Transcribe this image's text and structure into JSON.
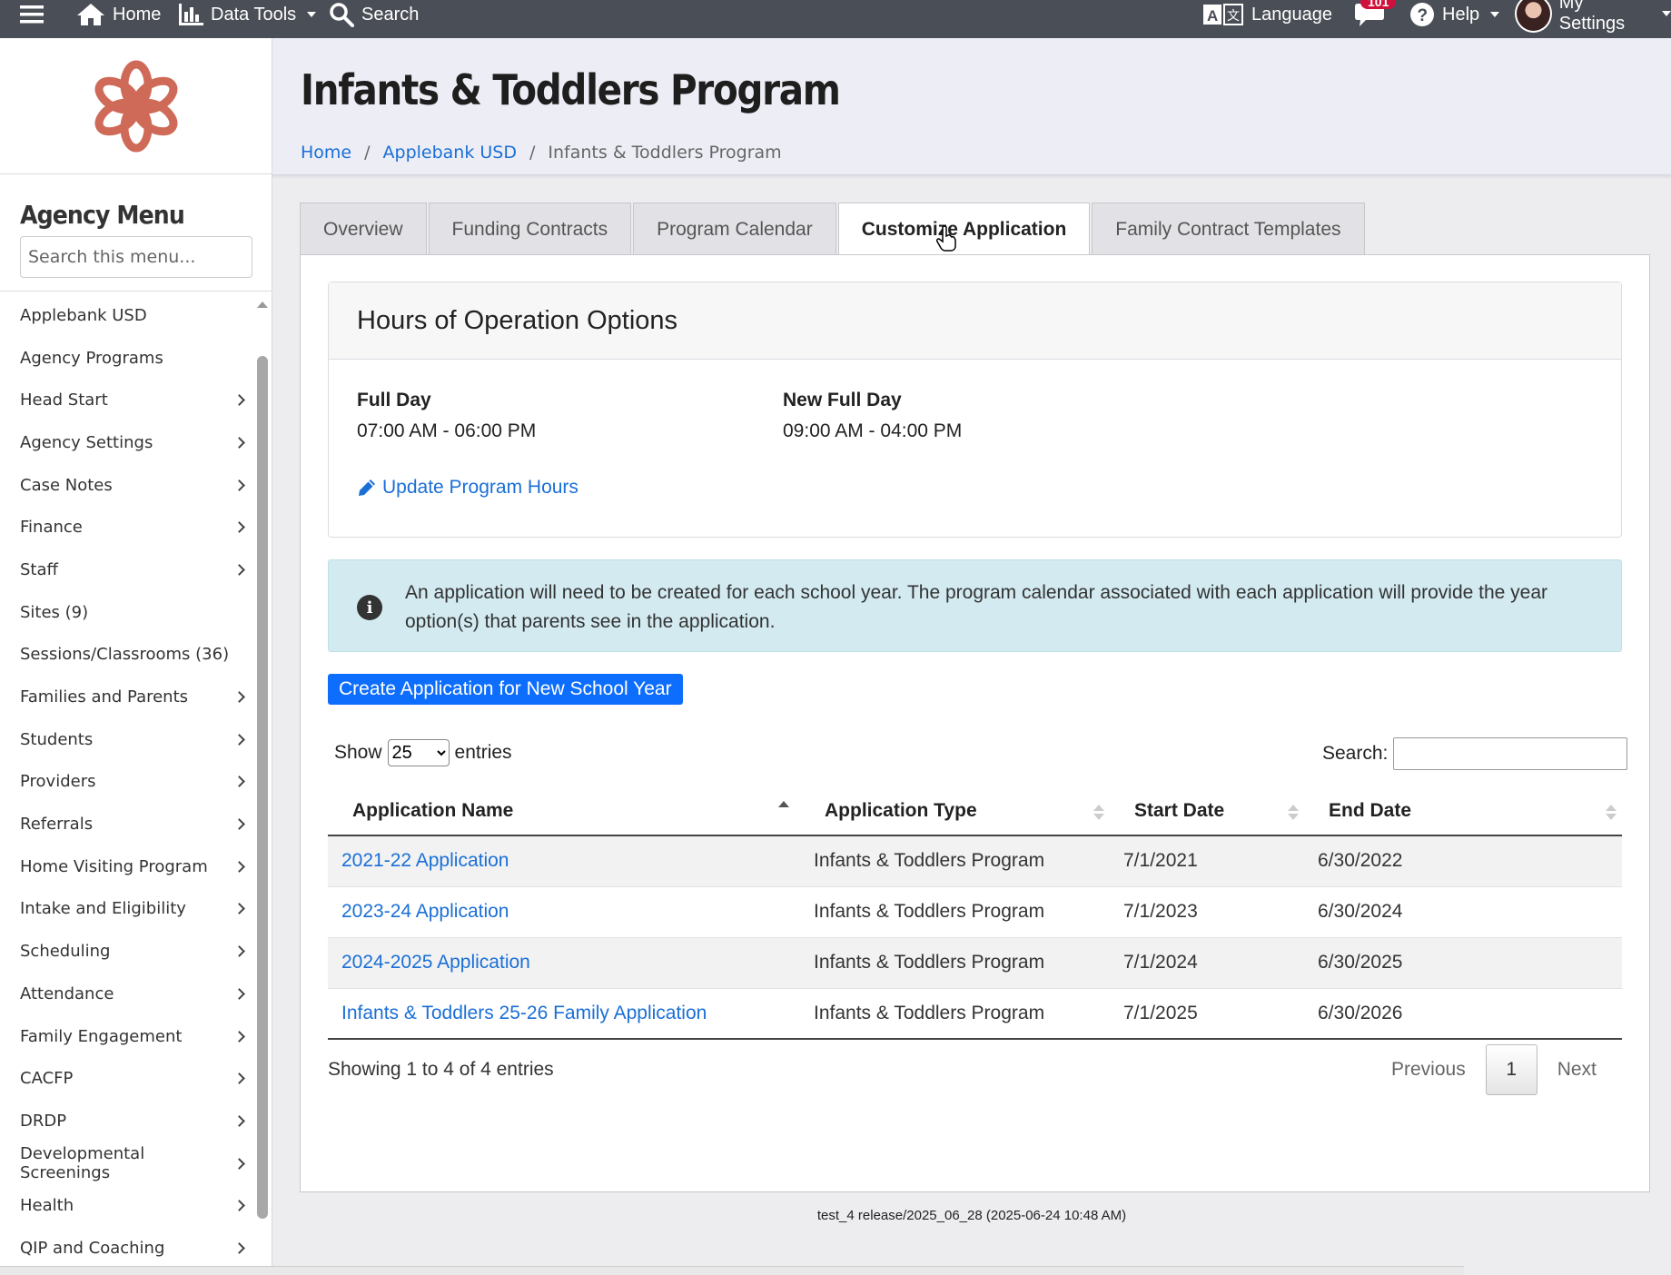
{
  "topbar": {
    "home": "Home",
    "data_tools": "Data Tools",
    "search": "Search",
    "language": "Language",
    "notifications_count": "101",
    "help": "Help",
    "my_settings": "My Settings"
  },
  "sidebar": {
    "title": "Agency Menu",
    "search_placeholder": "Search this menu...",
    "items": [
      {
        "label": "Applebank USD",
        "has_children": false
      },
      {
        "label": "Agency Programs",
        "has_children": false
      },
      {
        "label": "Head Start",
        "has_children": true
      },
      {
        "label": "Agency Settings",
        "has_children": true
      },
      {
        "label": "Case Notes",
        "has_children": true
      },
      {
        "label": "Finance",
        "has_children": true
      },
      {
        "label": "Staff",
        "has_children": true
      },
      {
        "label": "Sites (9)",
        "has_children": false
      },
      {
        "label": "Sessions/Classrooms (36)",
        "has_children": false
      },
      {
        "label": "Families and Parents",
        "has_children": true
      },
      {
        "label": "Students",
        "has_children": true
      },
      {
        "label": "Providers",
        "has_children": true
      },
      {
        "label": "Referrals",
        "has_children": true
      },
      {
        "label": "Home Visiting Program",
        "has_children": true
      },
      {
        "label": "Intake and Eligibility",
        "has_children": true
      },
      {
        "label": "Scheduling",
        "has_children": true
      },
      {
        "label": "Attendance",
        "has_children": true
      },
      {
        "label": "Family Engagement",
        "has_children": true
      },
      {
        "label": "CACFP",
        "has_children": true
      },
      {
        "label": "DRDP",
        "has_children": true
      },
      {
        "label": "Developmental Screenings",
        "has_children": true
      },
      {
        "label": "Health",
        "has_children": true
      },
      {
        "label": "QIP and Coaching",
        "has_children": true
      }
    ]
  },
  "header": {
    "title": "Infants & Toddlers Program",
    "breadcrumb": [
      "Home",
      "Applebank USD",
      "Infants & Toddlers Program"
    ]
  },
  "tabs": [
    {
      "label": "Overview",
      "active": false
    },
    {
      "label": "Funding Contracts",
      "active": false
    },
    {
      "label": "Program Calendar",
      "active": false
    },
    {
      "label": "Customize Application",
      "active": true
    },
    {
      "label": "Family Contract Templates",
      "active": false
    }
  ],
  "hours": {
    "title": "Hours of Operation Options",
    "options": [
      {
        "name": "Full Day",
        "range": "07:00 AM - 06:00 PM"
      },
      {
        "name": "New Full Day",
        "range": "09:00 AM - 04:00 PM"
      }
    ],
    "update_link": "Update Program Hours"
  },
  "alert": {
    "text": "An application will need to be created for each school year. The program calendar associated with each application will provide the year option(s) that parents see in the application."
  },
  "create_button": "Create Application for New School Year",
  "table_controls": {
    "show_label": "Show",
    "entries_value": "25",
    "entries_label": "entries",
    "search_label": "Search:"
  },
  "table": {
    "columns": [
      "Application Name",
      "Application Type",
      "Start Date",
      "End Date"
    ],
    "rows": [
      [
        "2021-22 Application",
        "Infants & Toddlers Program",
        "7/1/2021",
        "6/30/2022"
      ],
      [
        "2023-24 Application",
        "Infants & Toddlers Program",
        "7/1/2023",
        "6/30/2024"
      ],
      [
        "2024-2025 Application",
        "Infants & Toddlers Program",
        "7/1/2024",
        "6/30/2025"
      ],
      [
        "Infants & Toddlers 25-26 Family Application",
        "Infants & Toddlers Program",
        "7/1/2025",
        "6/30/2026"
      ]
    ]
  },
  "pagination": {
    "showing": "Showing 1 to 4 of 4 entries",
    "previous": "Previous",
    "page": "1",
    "next": "Next"
  },
  "footer": {
    "version": "test_4 release/2025_06_28 (2025-06-24 10:48 AM)"
  },
  "colors": {
    "topbar": "#4a4e56",
    "link": "#1a6fd6",
    "primary_button": "#0d6efd",
    "alert_bg": "#d2eaf0",
    "logo": "#d06a58",
    "badge": "#d0103a"
  }
}
